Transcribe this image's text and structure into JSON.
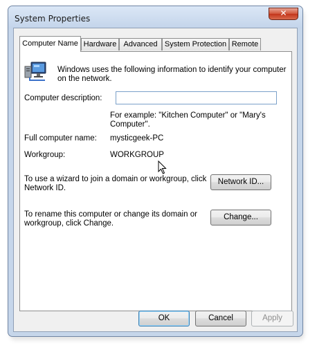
{
  "window": {
    "title": "System Properties",
    "close_symbol": "✕"
  },
  "tabs": [
    {
      "label": "Computer Name",
      "active": true
    },
    {
      "label": "Hardware",
      "active": false
    },
    {
      "label": "Advanced",
      "active": false
    },
    {
      "label": "System Protection",
      "active": false
    },
    {
      "label": "Remote",
      "active": false
    }
  ],
  "computer_name": {
    "intro_line1": "Windows uses the following information to identify your computer",
    "intro_line2": "on the network.",
    "description_label": "Computer description:",
    "description_value": "",
    "example_line1": "For example: \"Kitchen Computer\" or \"Mary's",
    "example_line2": "Computer\".",
    "full_name_label": "Full computer name:",
    "full_name_value": "mysticgeek-PC",
    "workgroup_label": "Workgroup:",
    "workgroup_value": "WORKGROUP",
    "network_id_text_line1": "To use a wizard to join a domain or workgroup, click",
    "network_id_text_line2": "Network ID.",
    "network_id_button": "Network ID...",
    "change_text_line1": "To rename this computer or change its domain or",
    "change_text_line2": "workgroup, click Change.",
    "change_button": "Change..."
  },
  "buttons": {
    "ok": "OK",
    "cancel": "Cancel",
    "apply": "Apply"
  },
  "icons": {
    "computer": "computer-network-icon",
    "cursor": "mouse-pointer-icon"
  }
}
